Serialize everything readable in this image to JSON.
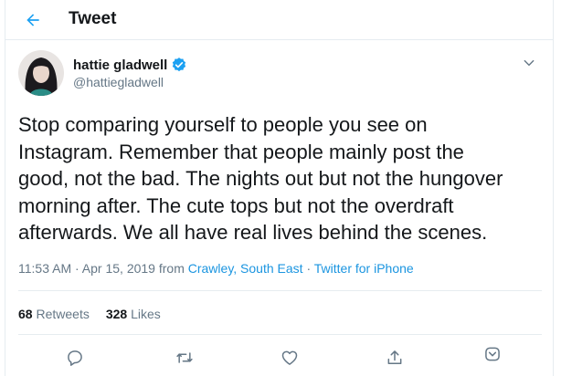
{
  "header": {
    "title": "Tweet",
    "back_icon": "arrow-left-icon"
  },
  "colors": {
    "accent": "#1da1f2",
    "link": "#1b95e0",
    "muted": "#657786",
    "text": "#14171a",
    "border": "#e6ecf0"
  },
  "author": {
    "display_name": "hattie gladwell",
    "handle": "@hattiegladwell",
    "verified": true
  },
  "tweet": {
    "text": "Stop comparing yourself to people you see on\nInstagram. Remember that people mainly post the\ngood, not the bad. The nights out but not the hungover\nmorning after. The cute tops but not the overdraft\nafterwards. We all have real lives behind the scenes.",
    "time": "11:53 AM",
    "date": "Apr 15, 2019",
    "from_label": "from",
    "location": "Crawley, South East",
    "source": "Twitter for iPhone"
  },
  "stats": {
    "retweets_count": "68",
    "retweets_label": "Retweets",
    "likes_count": "328",
    "likes_label": "Likes"
  },
  "actions": [
    "reply-icon",
    "retweet-icon",
    "like-icon",
    "share-icon",
    "bookmark-icon"
  ]
}
